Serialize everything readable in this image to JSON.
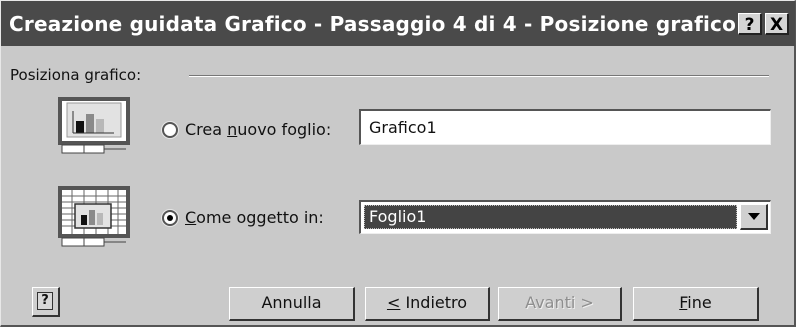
{
  "titlebar": {
    "title": "Creazione guidata Grafico - Passaggio 4 di 4 - Posizione grafico",
    "help_label": "?",
    "close_label": "X"
  },
  "group": {
    "label": "Posiziona grafico:"
  },
  "options": [
    {
      "label_pre": "Crea ",
      "label_mnemonic": "n",
      "label_post": "uovo foglio:",
      "value": "Grafico1",
      "selected": false,
      "icon": "new-sheet-chart-icon"
    },
    {
      "label_pre": "",
      "label_mnemonic": "C",
      "label_post": "ome oggetto in:",
      "value": "Foglio1",
      "selected": true,
      "icon": "embedded-chart-icon"
    }
  ],
  "buttons": {
    "help_label": "?",
    "cancel_label": "Annulla",
    "back_mnemonic": "<",
    "back_rest": " Indietro",
    "next_label": "Avanti >",
    "finish_mnemonic": "F",
    "finish_rest": "ine",
    "next_disabled": true
  },
  "colors": {
    "titlebar": "#4a4a4a",
    "dialog_bg": "#c9c9c9",
    "selection": "#444444"
  }
}
